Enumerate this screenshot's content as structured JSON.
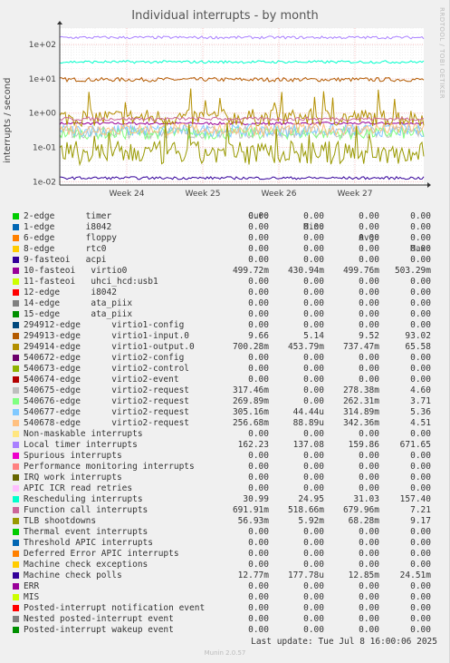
{
  "title": "Individual interrupts - by month",
  "ylabel": "interrupts / second",
  "watermark": "RRDTOOL / TOBI OETIKER",
  "footer": "Munin 2.0.57",
  "last_update": "Last update: Tue Jul  8 16:00:06 2025",
  "legend_headers": {
    "cur": "Cur:",
    "min": "Min:",
    "avg": "Avg:",
    "max": "Max:"
  },
  "chart_data": {
    "type": "line",
    "title": "Individual interrupts - by month",
    "ylabel": "interrupts / second",
    "y_scale": "log",
    "ylim": [
      0.008,
      300
    ],
    "y_ticks": [
      0.01,
      0.1,
      1,
      10,
      100
    ],
    "y_tick_labels": [
      "1e-02",
      "1e-01",
      "1e+00",
      "1e+01",
      "1e+02"
    ],
    "x_tick_labels": [
      "Week 24",
      "Week 25",
      "Week 26",
      "Week 27"
    ],
    "grid": true,
    "series": [
      {
        "name": "2-edge      timer",
        "color": "#00cc00",
        "cur": "0.00",
        "min": "0.00",
        "avg": "0.00",
        "max": "0.00"
      },
      {
        "name": "1-edge      i8042",
        "color": "#0066b3",
        "cur": "0.00",
        "min": "0.00",
        "avg": "0.00",
        "max": "0.00"
      },
      {
        "name": "6-edge      floppy",
        "color": "#ff8000",
        "cur": "0.00",
        "min": "0.00",
        "avg": "0.00",
        "max": "0.00"
      },
      {
        "name": "8-edge      rtc0",
        "color": "#ffcc00",
        "cur": "0.00",
        "min": "0.00",
        "avg": "0.00",
        "max": "0.00"
      },
      {
        "name": "9-fasteoi   acpi",
        "color": "#330099",
        "cur": "0.00",
        "min": "0.00",
        "avg": "0.00",
        "max": "0.00"
      },
      {
        "name": "10-fasteoi   virtio0",
        "color": "#990099",
        "cur": "499.72m",
        "min": "430.94m",
        "avg": "499.76m",
        "max": "503.29m",
        "level": 0.5
      },
      {
        "name": "11-fasteoi   uhci_hcd:usb1",
        "color": "#ccff00",
        "cur": "0.00",
        "min": "0.00",
        "avg": "0.00",
        "max": "0.00"
      },
      {
        "name": "12-edge      i8042",
        "color": "#ff0000",
        "cur": "0.00",
        "min": "0.00",
        "avg": "0.00",
        "max": "0.00"
      },
      {
        "name": "14-edge      ata_piix",
        "color": "#808080",
        "cur": "0.00",
        "min": "0.00",
        "avg": "0.00",
        "max": "0.00"
      },
      {
        "name": "15-edge      ata_piix",
        "color": "#008f00",
        "cur": "0.00",
        "min": "0.00",
        "avg": "0.00",
        "max": "0.00"
      },
      {
        "name": "294912-edge      virtio1-config",
        "color": "#00487d",
        "cur": "0.00",
        "min": "0.00",
        "avg": "0.00",
        "max": "0.00"
      },
      {
        "name": "294913-edge      virtio1-input.0",
        "color": "#b35a00",
        "cur": "9.66",
        "min": "5.14",
        "avg": "9.52",
        "max": "93.02",
        "level": 9.5
      },
      {
        "name": "294914-edge      virtio1-output.0",
        "color": "#b38f00",
        "cur": "700.28m",
        "min": "453.79m",
        "avg": "737.47m",
        "max": "65.58",
        "level": 0.74
      },
      {
        "name": "540672-edge      virtio2-config",
        "color": "#6b006b",
        "cur": "0.00",
        "min": "0.00",
        "avg": "0.00",
        "max": "0.00"
      },
      {
        "name": "540673-edge      virtio2-control",
        "color": "#8fb300",
        "cur": "0.00",
        "min": "0.00",
        "avg": "0.00",
        "max": "0.00"
      },
      {
        "name": "540674-edge      virtio2-event",
        "color": "#b30000",
        "cur": "0.00",
        "min": "0.00",
        "avg": "0.00",
        "max": "0.00"
      },
      {
        "name": "540675-edge      virtio2-request",
        "color": "#bebebe",
        "cur": "317.46m",
        "min": "0.00",
        "avg": "278.38m",
        "max": "4.60",
        "level": 0.28
      },
      {
        "name": "540676-edge      virtio2-request",
        "color": "#80ff80",
        "cur": "269.89m",
        "min": "0.00",
        "avg": "262.31m",
        "max": "3.71",
        "level": 0.26
      },
      {
        "name": "540677-edge      virtio2-request",
        "color": "#80c9ff",
        "cur": "305.16m",
        "min": "44.44u",
        "avg": "314.89m",
        "max": "5.36",
        "level": 0.31
      },
      {
        "name": "540678-edge      virtio2-request",
        "color": "#ffc080",
        "cur": "256.68m",
        "min": "88.89u",
        "avg": "342.36m",
        "max": "4.51",
        "level": 0.34
      },
      {
        "name": "Non-maskable interrupts",
        "color": "#ffe680",
        "cur": "0.00",
        "min": "0.00",
        "avg": "0.00",
        "max": "0.00"
      },
      {
        "name": "Local timer interrupts",
        "color": "#aa80ff",
        "cur": "162.23",
        "min": "137.08",
        "avg": "159.86",
        "max": "671.65",
        "level": 160
      },
      {
        "name": "Spurious interrupts",
        "color": "#ee00cc",
        "cur": "0.00",
        "min": "0.00",
        "avg": "0.00",
        "max": "0.00"
      },
      {
        "name": "Performance monitoring interrupts",
        "color": "#ff8080",
        "cur": "0.00",
        "min": "0.00",
        "avg": "0.00",
        "max": "0.00"
      },
      {
        "name": "IRQ work interrupts",
        "color": "#666600",
        "cur": "0.00",
        "min": "0.00",
        "avg": "0.00",
        "max": "0.00"
      },
      {
        "name": "APIC ICR read retries",
        "color": "#ffbfff",
        "cur": "0.00",
        "min": "0.00",
        "avg": "0.00",
        "max": "0.00"
      },
      {
        "name": "Rescheduling interrupts",
        "color": "#00ffcc",
        "cur": "30.99",
        "min": "24.95",
        "avg": "31.03",
        "max": "157.40",
        "level": 31
      },
      {
        "name": "Function call interrupts",
        "color": "#cc6699",
        "cur": "691.91m",
        "min": "518.66m",
        "avg": "679.96m",
        "max": "7.21",
        "level": 0.68
      },
      {
        "name": "TLB shootdowns",
        "color": "#999900",
        "cur": "56.93m",
        "min": "5.92m",
        "avg": "68.28m",
        "max": "9.17",
        "level": 0.068
      },
      {
        "name": "Thermal event interrupts",
        "color": "#00cc00",
        "cur": "0.00",
        "min": "0.00",
        "avg": "0.00",
        "max": "0.00"
      },
      {
        "name": "Threshold APIC interrupts",
        "color": "#0066b3",
        "cur": "0.00",
        "min": "0.00",
        "avg": "0.00",
        "max": "0.00"
      },
      {
        "name": "Deferred Error APIC interrupts",
        "color": "#ff8000",
        "cur": "0.00",
        "min": "0.00",
        "avg": "0.00",
        "max": "0.00"
      },
      {
        "name": "Machine check exceptions",
        "color": "#ffcc00",
        "cur": "0.00",
        "min": "0.00",
        "avg": "0.00",
        "max": "0.00"
      },
      {
        "name": "Machine check polls",
        "color": "#330099",
        "cur": "12.77m",
        "min": "177.78u",
        "avg": "12.85m",
        "max": "24.51m",
        "level": 0.0128
      },
      {
        "name": "ERR",
        "color": "#990099",
        "cur": "0.00",
        "min": "0.00",
        "avg": "0.00",
        "max": "0.00"
      },
      {
        "name": "MIS",
        "color": "#ccff00",
        "cur": "0.00",
        "min": "0.00",
        "avg": "0.00",
        "max": "0.00"
      },
      {
        "name": "Posted-interrupt notification event",
        "color": "#ff0000",
        "cur": "0.00",
        "min": "0.00",
        "avg": "0.00",
        "max": "0.00"
      },
      {
        "name": "Nested posted-interrupt event",
        "color": "#808080",
        "cur": "0.00",
        "min": "0.00",
        "avg": "0.00",
        "max": "0.00"
      },
      {
        "name": "Posted-interrupt wakeup event",
        "color": "#008f00",
        "cur": "0.00",
        "min": "0.00",
        "avg": "0.00",
        "max": "0.00"
      }
    ]
  }
}
